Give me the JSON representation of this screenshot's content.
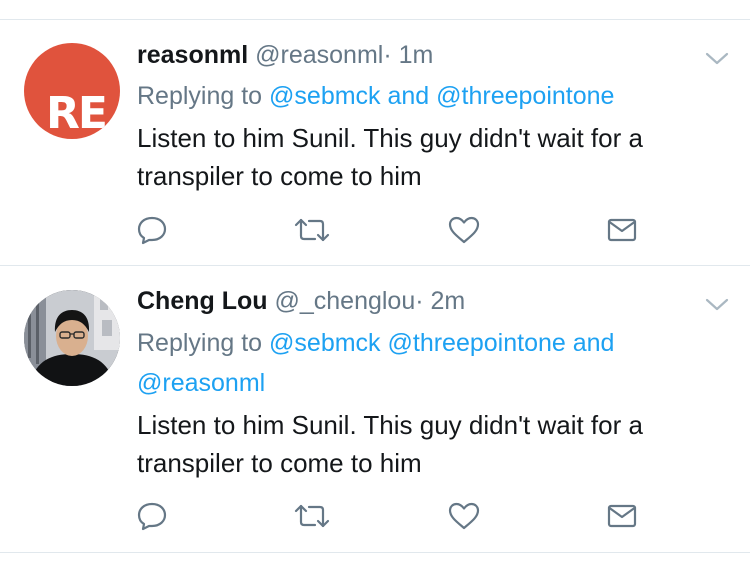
{
  "tweets": [
    {
      "avatar_text": "RE",
      "display_name": "reasonml",
      "handle": "@reasonml",
      "separator": "·",
      "time": "1m",
      "replying_prefix": "Replying to",
      "reply_line1": [
        {
          "text": "@sebmck",
          "mention": true
        },
        {
          "text": " and ",
          "mention": true
        },
        {
          "text": "@threepointone",
          "mention": true
        }
      ],
      "reply_line2": [],
      "text": "Listen to him Sunil. This guy didn't wait for a transpiler to come to him",
      "icons": [
        "chevron-down-icon",
        "reply-icon",
        "retweet-icon",
        "like-icon",
        "message-icon"
      ]
    },
    {
      "avatar_text": "",
      "display_name": "Cheng Lou",
      "handle": "@_chenglou",
      "separator": "·",
      "time": "2m",
      "replying_prefix": "Replying to",
      "reply_line1": [
        {
          "text": "@sebmck",
          "mention": true
        },
        {
          "text": " ",
          "mention": false
        },
        {
          "text": "@threepointone",
          "mention": true
        },
        {
          "text": " and",
          "mention": true
        }
      ],
      "reply_line2": [
        {
          "text": "@reasonml",
          "mention": true
        }
      ],
      "text": "Listen to him Sunil. This guy didn't wait for a transpiler to come to him",
      "icons": [
        "chevron-down-icon",
        "reply-icon",
        "retweet-icon",
        "like-icon",
        "message-icon"
      ]
    }
  ],
  "colors": {
    "link": "#1da1f2",
    "secondary": "#657786",
    "icon": "#657786",
    "avatar_brand": "#e0533d",
    "divider": "#e1e8ed"
  }
}
